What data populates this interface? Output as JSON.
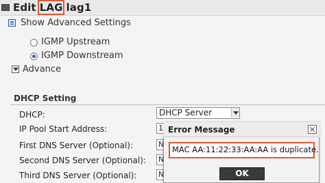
{
  "window": {
    "title_prefix": "Edit",
    "title_highlight": "LAG",
    "title_suffix": "lag1"
  },
  "advanced": {
    "toggle_label": "Show Advanced Settings"
  },
  "igmp": {
    "options": [
      {
        "label": "IGMP Upstream",
        "checked": false
      },
      {
        "label": "IGMP Downstream",
        "checked": true
      }
    ]
  },
  "advance": {
    "label": "Advance"
  },
  "dhcp": {
    "section_title": "DHCP Setting",
    "rows": [
      {
        "label": "DHCP:"
      },
      {
        "label": "IP Pool Start Address:"
      },
      {
        "label": "First DNS Server (Optional):"
      },
      {
        "label": "Second DNS Server (Optional):"
      },
      {
        "label": "Third DNS Server (Optional):"
      }
    ],
    "dhcp_value": "DHCP Server",
    "ip_pool_stub": "1",
    "dns_stub_1": "N",
    "dns_stub_2": "N",
    "dns_stub_3": "N"
  },
  "dialog": {
    "title": "Error Message",
    "message": "MAC AA:11:22:33:AA:AA is duplicate.",
    "ok_label": "OK"
  },
  "colors": {
    "highlight": "#e0583a",
    "accent": "#2b5fa8",
    "ok_button": "#3a3a3a"
  }
}
